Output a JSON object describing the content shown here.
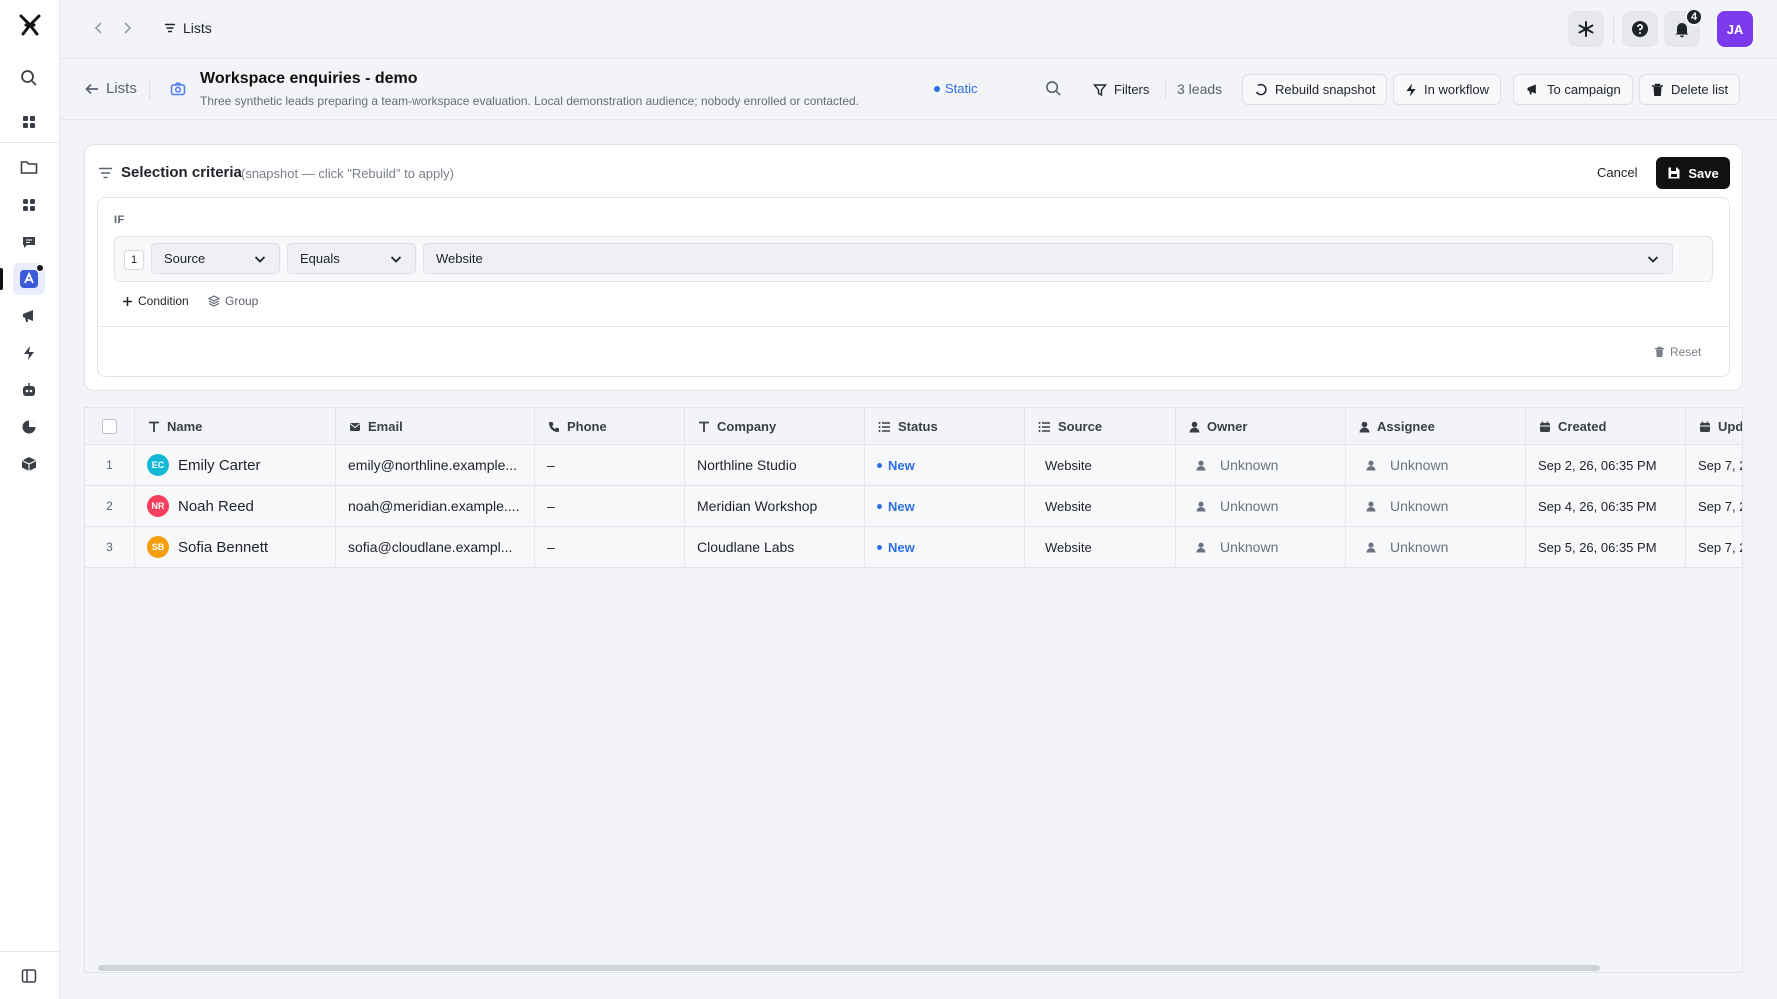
{
  "breadcrumb": {
    "label": "Lists"
  },
  "notifications": {
    "count": "4"
  },
  "user": {
    "initials": "JA"
  },
  "header": {
    "back_label": "Lists",
    "title": "Workspace enquiries - demo",
    "description": "Three synthetic leads preparing a team-workspace evaluation. Local demonstration audience; nobody enrolled or contacted.",
    "type_tag": "Static",
    "filters_label": "Filters",
    "lead_count": "3 leads",
    "rebuild_label": "Rebuild snapshot",
    "workflow_label": "In workflow",
    "campaign_label": "To campaign",
    "delete_label": "Delete list"
  },
  "criteria": {
    "title": "Selection criteria",
    "subtitle": "(snapshot — click \"Rebuild\" to apply)",
    "cancel_label": "Cancel",
    "save_label": "Save",
    "if_label": "IF",
    "condition": {
      "index": "1",
      "field": "Source",
      "operator": "Equals",
      "value": "Website"
    },
    "add_condition_label": "Condition",
    "add_group_label": "Group",
    "reset_label": "Reset"
  },
  "table": {
    "columns": [
      "Name",
      "Email",
      "Phone",
      "Company",
      "Status",
      "Source",
      "Owner",
      "Assignee",
      "Created",
      "Upd"
    ],
    "rows": [
      {
        "num": "1",
        "initials": "EC",
        "avatar_color": "#14b8d4",
        "name": "Emily Carter",
        "email": "emily@northline.example...",
        "phone": "–",
        "company": "Northline Studio",
        "status": "New",
        "source": "Website",
        "owner": "Unknown",
        "assignee": "Unknown",
        "created": "Sep 2, 26, 06:35 PM",
        "updated": "Sep 7, 2"
      },
      {
        "num": "2",
        "initials": "NR",
        "avatar_color": "#f43f5e",
        "name": "Noah Reed",
        "email": "noah@meridian.example....",
        "phone": "–",
        "company": "Meridian Workshop",
        "status": "New",
        "source": "Website",
        "owner": "Unknown",
        "assignee": "Unknown",
        "created": "Sep 4, 26, 06:35 PM",
        "updated": "Sep 7, 2"
      },
      {
        "num": "3",
        "initials": "SB",
        "avatar_color": "#f59e0b",
        "name": "Sofia Bennett",
        "email": "sofia@cloudlane.exampl...",
        "phone": "–",
        "company": "Cloudlane Labs",
        "status": "New",
        "source": "Website",
        "owner": "Unknown",
        "assignee": "Unknown",
        "created": "Sep 5, 26, 06:35 PM",
        "updated": "Sep 7, 2"
      }
    ]
  },
  "colors": {
    "accent": "#2f6fe4",
    "primary_button": "#111111",
    "avatar_user": "#7c3aed"
  }
}
